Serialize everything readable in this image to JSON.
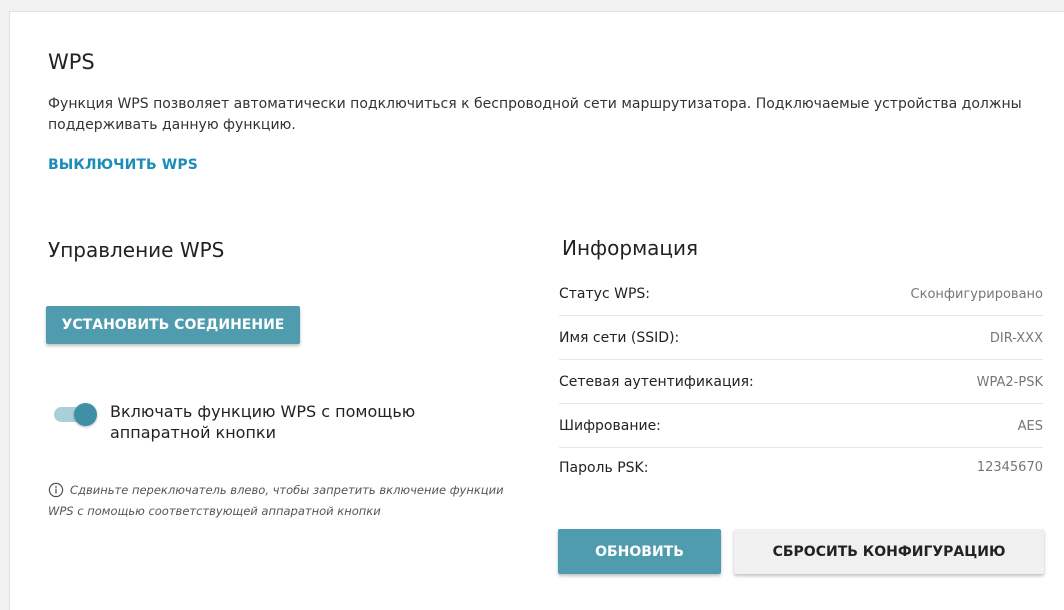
{
  "wps": {
    "title": "WPS",
    "description": "Функция WPS позволяет автоматически подключиться к беспроводной сети маршрутизатора. Подключаемые устройства должны поддерживать данную функцию.",
    "disable_link": "ВЫКЛЮЧИТЬ WPS"
  },
  "management": {
    "title": "Управление WPS",
    "connect_button": "УСТАНОВИТЬ СОЕДИНЕНИЕ",
    "toggle_label": "Включать функцию WPS с помощью аппаратной кнопки",
    "toggle_on": true,
    "hint_icon": "info-circle-icon",
    "hint": "Сдвиньте переключатель влево, чтобы запретить включение функции WPS с помощью соответствующей аппаратной кнопки"
  },
  "info": {
    "title": "Информация",
    "rows": [
      {
        "label": "Статус WPS:",
        "value": "Сконфигурировано"
      },
      {
        "label": "Имя сети (SSID):",
        "value": "DIR-XXX"
      },
      {
        "label": "Сетевая аутентификация:",
        "value": "WPA2-PSK"
      },
      {
        "label": "Шифрование:",
        "value": "AES"
      },
      {
        "label": "Пароль PSK:",
        "value": "12345670"
      }
    ],
    "refresh_button": "ОБНОВИТЬ",
    "reset_button": "СБРОСИТЬ КОНФИГУРАЦИЮ"
  },
  "colors": {
    "accent": "#4f9cae",
    "link": "#1c8db7"
  }
}
